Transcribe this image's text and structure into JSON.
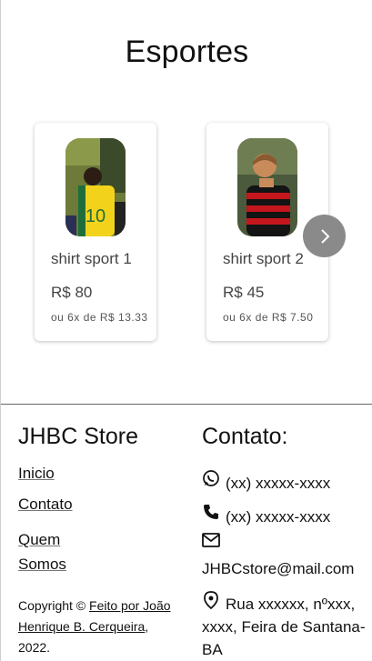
{
  "section": {
    "title": "Esportes"
  },
  "products": [
    {
      "name": "shirt sport 1",
      "price": "R$ 80",
      "installments": "ou 6x de R$ 13.33"
    },
    {
      "name": "shirt sport 2",
      "price": "R$ 45",
      "installments": "ou 6x de R$ 7.50"
    }
  ],
  "carousel": {
    "next_icon": "chevron-right-icon"
  },
  "footer": {
    "store_name": "JHBC Store",
    "links": [
      "Inicio",
      "Contato",
      "Quem Somos"
    ],
    "copyright_prefix": "Copyright ©",
    "copyright_link": "Feito por João Henrique B. Cerqueira",
    "copyright_suffix": ", 2022.",
    "contact_title": "Contato:",
    "whatsapp": "(xx) xxxxx-xxxx",
    "phone": "(xx) xxxxx-xxxx",
    "email": "JHBCstore@mail.com",
    "address": "Rua xxxxxx, nºxxx, xxxx, Feira de Santana-BA"
  }
}
